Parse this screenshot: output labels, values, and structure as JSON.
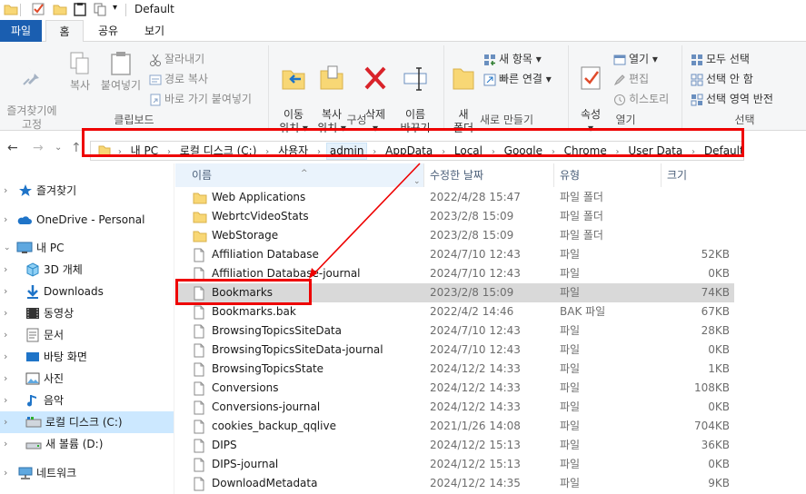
{
  "window": {
    "title": "Default"
  },
  "tabs": {
    "file": "파일",
    "home": "홈",
    "share": "공유",
    "view": "보기"
  },
  "ribbon": {
    "clipboard": {
      "label": "클립보드",
      "pin": "즐겨찾기에\n고정",
      "copy": "복사",
      "paste": "붙여넣기",
      "cut": "잘라내기",
      "copy_path": "경로 복사",
      "paste_shortcut": "바로 가기 붙여넣기"
    },
    "organize": {
      "label": "구성",
      "move_to": "이동\n위치 ▾",
      "copy_to": "복사\n위치 ▾",
      "delete": "삭제\n▾",
      "rename": "이름\n바꾸기"
    },
    "new": {
      "label": "새로 만들기",
      "new_folder": "새\n폴더",
      "new_item": "새 항목 ▾",
      "easy_access": "빠른 연결 ▾"
    },
    "open": {
      "label": "열기",
      "properties": "속성\n▾",
      "open": "열기 ▾",
      "edit": "편집",
      "history": "히스토리"
    },
    "select": {
      "label": "선택",
      "select_all": "모두 선택",
      "select_none": "선택 안 함",
      "invert": "선택 영역 반전"
    }
  },
  "address": {
    "crumbs": [
      "내 PC",
      "로컬 디스크 (C:)",
      "사용자",
      "admin",
      "AppData",
      "Local",
      "Google",
      "Chrome",
      "User Data",
      "Default"
    ]
  },
  "nav": {
    "items": [
      {
        "label": "즐겨찾기",
        "icon": "star-icon"
      },
      {
        "label": "OneDrive - Personal",
        "icon": "cloud-icon"
      },
      {
        "label": "내 PC",
        "icon": "computer-icon"
      },
      {
        "label": "3D 개체",
        "icon": "cube-icon"
      },
      {
        "label": "Downloads",
        "icon": "download-icon"
      },
      {
        "label": "동영상",
        "icon": "video-icon"
      },
      {
        "label": "문서",
        "icon": "document-icon"
      },
      {
        "label": "바탕 화면",
        "icon": "desktop-icon"
      },
      {
        "label": "사진",
        "icon": "picture-icon"
      },
      {
        "label": "음악",
        "icon": "music-icon"
      },
      {
        "label": "로컬 디스크 (C:)",
        "icon": "drive-icon"
      },
      {
        "label": "새 볼륨 (D:)",
        "icon": "drive-icon"
      },
      {
        "label": "네트워크",
        "icon": "network-icon"
      }
    ]
  },
  "list": {
    "columns": {
      "name": "이름",
      "date": "수정한 날짜",
      "type": "유형",
      "size": "크기"
    },
    "rows": [
      {
        "name": "Web Applications",
        "date": "2022/4/28 15:47",
        "type": "파일 폴더",
        "size": "",
        "kind": "folder"
      },
      {
        "name": "WebrtcVideoStats",
        "date": "2023/2/8 15:09",
        "type": "파일 폴더",
        "size": "",
        "kind": "folder"
      },
      {
        "name": "WebStorage",
        "date": "2023/2/8 15:09",
        "type": "파일 폴더",
        "size": "",
        "kind": "folder"
      },
      {
        "name": "Affiliation Database",
        "date": "2024/7/10 12:43",
        "type": "파일",
        "size": "52KB",
        "kind": "file"
      },
      {
        "name": "Affiliation Database-journal",
        "date": "2024/7/10 12:43",
        "type": "파일",
        "size": "0KB",
        "kind": "file"
      },
      {
        "name": "Bookmarks",
        "date": "2023/2/8 15:09",
        "type": "파일",
        "size": "74KB",
        "kind": "file"
      },
      {
        "name": "Bookmarks.bak",
        "date": "2022/4/2 14:46",
        "type": "BAK 파일",
        "size": "67KB",
        "kind": "file"
      },
      {
        "name": "BrowsingTopicsSiteData",
        "date": "2024/7/10 12:43",
        "type": "파일",
        "size": "28KB",
        "kind": "file"
      },
      {
        "name": "BrowsingTopicsSiteData-journal",
        "date": "2024/7/10 12:43",
        "type": "파일",
        "size": "0KB",
        "kind": "file"
      },
      {
        "name": "BrowsingTopicsState",
        "date": "2024/12/2 14:33",
        "type": "파일",
        "size": "1KB",
        "kind": "file"
      },
      {
        "name": "Conversions",
        "date": "2024/12/2 14:33",
        "type": "파일",
        "size": "108KB",
        "kind": "file"
      },
      {
        "name": "Conversions-journal",
        "date": "2024/12/2 14:33",
        "type": "파일",
        "size": "0KB",
        "kind": "file"
      },
      {
        "name": "cookies_backup_qqlive",
        "date": "2021/1/26 14:08",
        "type": "파일",
        "size": "704KB",
        "kind": "file"
      },
      {
        "name": "DIPS",
        "date": "2024/12/2 15:13",
        "type": "파일",
        "size": "36KB",
        "kind": "file"
      },
      {
        "name": "DIPS-journal",
        "date": "2024/12/2 15:13",
        "type": "파일",
        "size": "0KB",
        "kind": "file"
      },
      {
        "name": "DownloadMetadata",
        "date": "2024/12/2 14:35",
        "type": "파일",
        "size": "9KB",
        "kind": "file"
      }
    ],
    "selected_index": 5
  },
  "colors": {
    "accent": "#1a5eb0",
    "highlight_box": "#e00000",
    "selection": "#cce8ff",
    "folder": "#f8d775"
  }
}
